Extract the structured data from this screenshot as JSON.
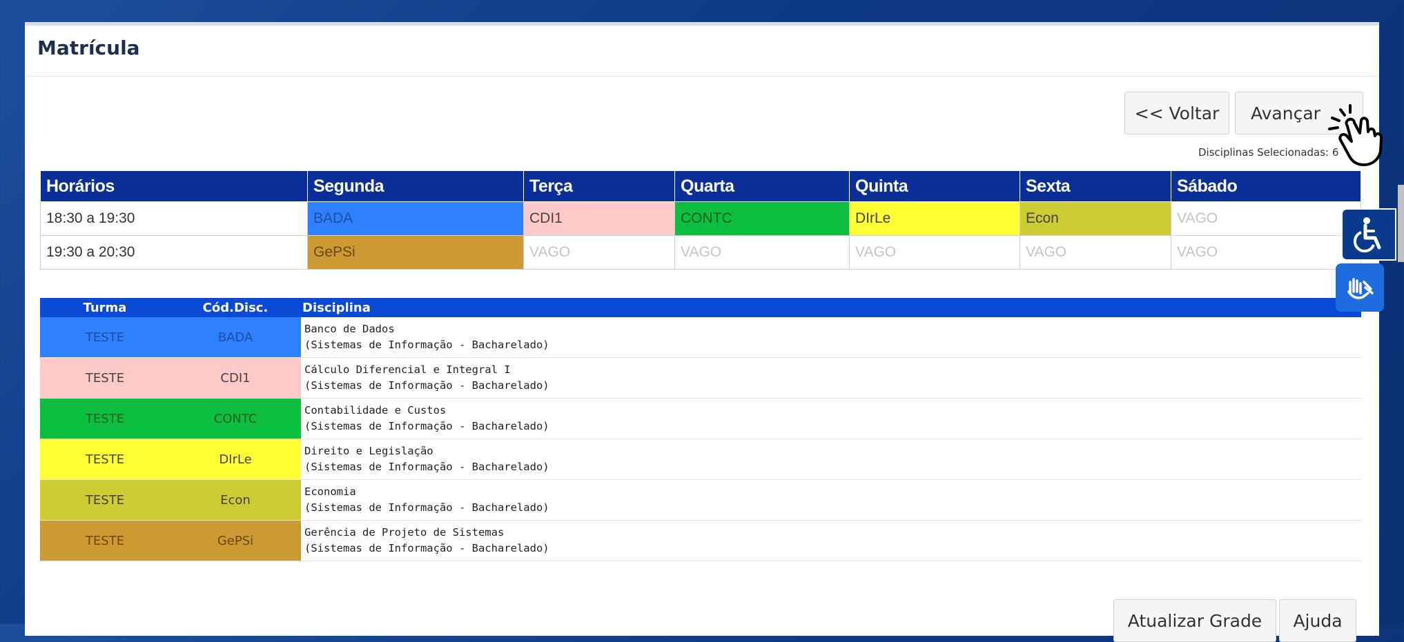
{
  "header": {
    "title": "Matrícula"
  },
  "buttons": {
    "voltar": "<< Voltar",
    "avancar": "Avançar",
    "atualizar": "Atualizar Grade",
    "ajuda": "Ajuda"
  },
  "selected_label": "Disciplinas Selecionadas: 6",
  "schedule": {
    "headers": [
      "Horários",
      "Segunda",
      "Terça",
      "Quarta",
      "Quinta",
      "Sexta",
      "Sábado"
    ],
    "rows": [
      {
        "time": "18:30 a 19:30",
        "cells": [
          {
            "text": "BADA",
            "color": "#2f80fe",
            "textcolor": "#1f4fa0"
          },
          {
            "text": "CDI1",
            "color": "#ffc9c9",
            "textcolor": "#444"
          },
          {
            "text": "CONTC",
            "color": "#0cbf3f",
            "textcolor": "#1f5f1f"
          },
          {
            "text": "DIrLe",
            "color": "#ffff33",
            "textcolor": "#444"
          },
          {
            "text": "Econ",
            "color": "#cccc33",
            "textcolor": "#444"
          },
          {
            "text": "VAGO",
            "color": "#ffffff",
            "textcolor": "#c4c4c4"
          }
        ]
      },
      {
        "time": "19:30 a 20:30",
        "cells": [
          {
            "text": "GePSi",
            "color": "#cc9933",
            "textcolor": "#6a4a12"
          },
          {
            "text": "VAGO",
            "color": "#ffffff",
            "textcolor": "#c4c4c4"
          },
          {
            "text": "VAGO",
            "color": "#ffffff",
            "textcolor": "#c4c4c4"
          },
          {
            "text": "VAGO",
            "color": "#ffffff",
            "textcolor": "#c4c4c4"
          },
          {
            "text": "VAGO",
            "color": "#ffffff",
            "textcolor": "#c4c4c4"
          },
          {
            "text": "VAGO",
            "color": "#ffffff",
            "textcolor": "#c4c4c4"
          }
        ]
      }
    ]
  },
  "disciplines": {
    "headers": [
      "Turma",
      "Cód.Disc.",
      "Disciplina"
    ],
    "rows": [
      {
        "turma": "TESTE",
        "codigo": "BADA",
        "nome": "Banco de Dados",
        "curso": "(Sistemas de Informação - Bacharelado)",
        "color": "#2f80fe",
        "textcolor": "#1f4fa0"
      },
      {
        "turma": "TESTE",
        "codigo": "CDI1",
        "nome": "Cálculo Diferencial e Integral I",
        "curso": "(Sistemas de Informação - Bacharelado)",
        "color": "#ffc9c9",
        "textcolor": "#444"
      },
      {
        "turma": "TESTE",
        "codigo": "CONTC",
        "nome": "Contabilidade e Custos",
        "curso": "(Sistemas de Informação - Bacharelado)",
        "color": "#0cbf3f",
        "textcolor": "#1f5f1f"
      },
      {
        "turma": "TESTE",
        "codigo": "DIrLe",
        "nome": "Direito e Legislação",
        "curso": "(Sistemas de Informação - Bacharelado)",
        "color": "#ffff33",
        "textcolor": "#444"
      },
      {
        "turma": "TESTE",
        "codigo": "Econ",
        "nome": "Economia",
        "curso": "(Sistemas de Informação - Bacharelado)",
        "color": "#cccc33",
        "textcolor": "#444"
      },
      {
        "turma": "TESTE",
        "codigo": "GePSi",
        "nome": "Gerência de Projeto de Sistemas",
        "curso": "(Sistemas de Informação - Bacharelado)",
        "color": "#cc9933",
        "textcolor": "#6a4a12"
      }
    ]
  },
  "icons": {
    "accessibility": "wheelchair-icon",
    "libras": "sign-language-hands-icon",
    "cursor": "hand-pointer-icon"
  }
}
